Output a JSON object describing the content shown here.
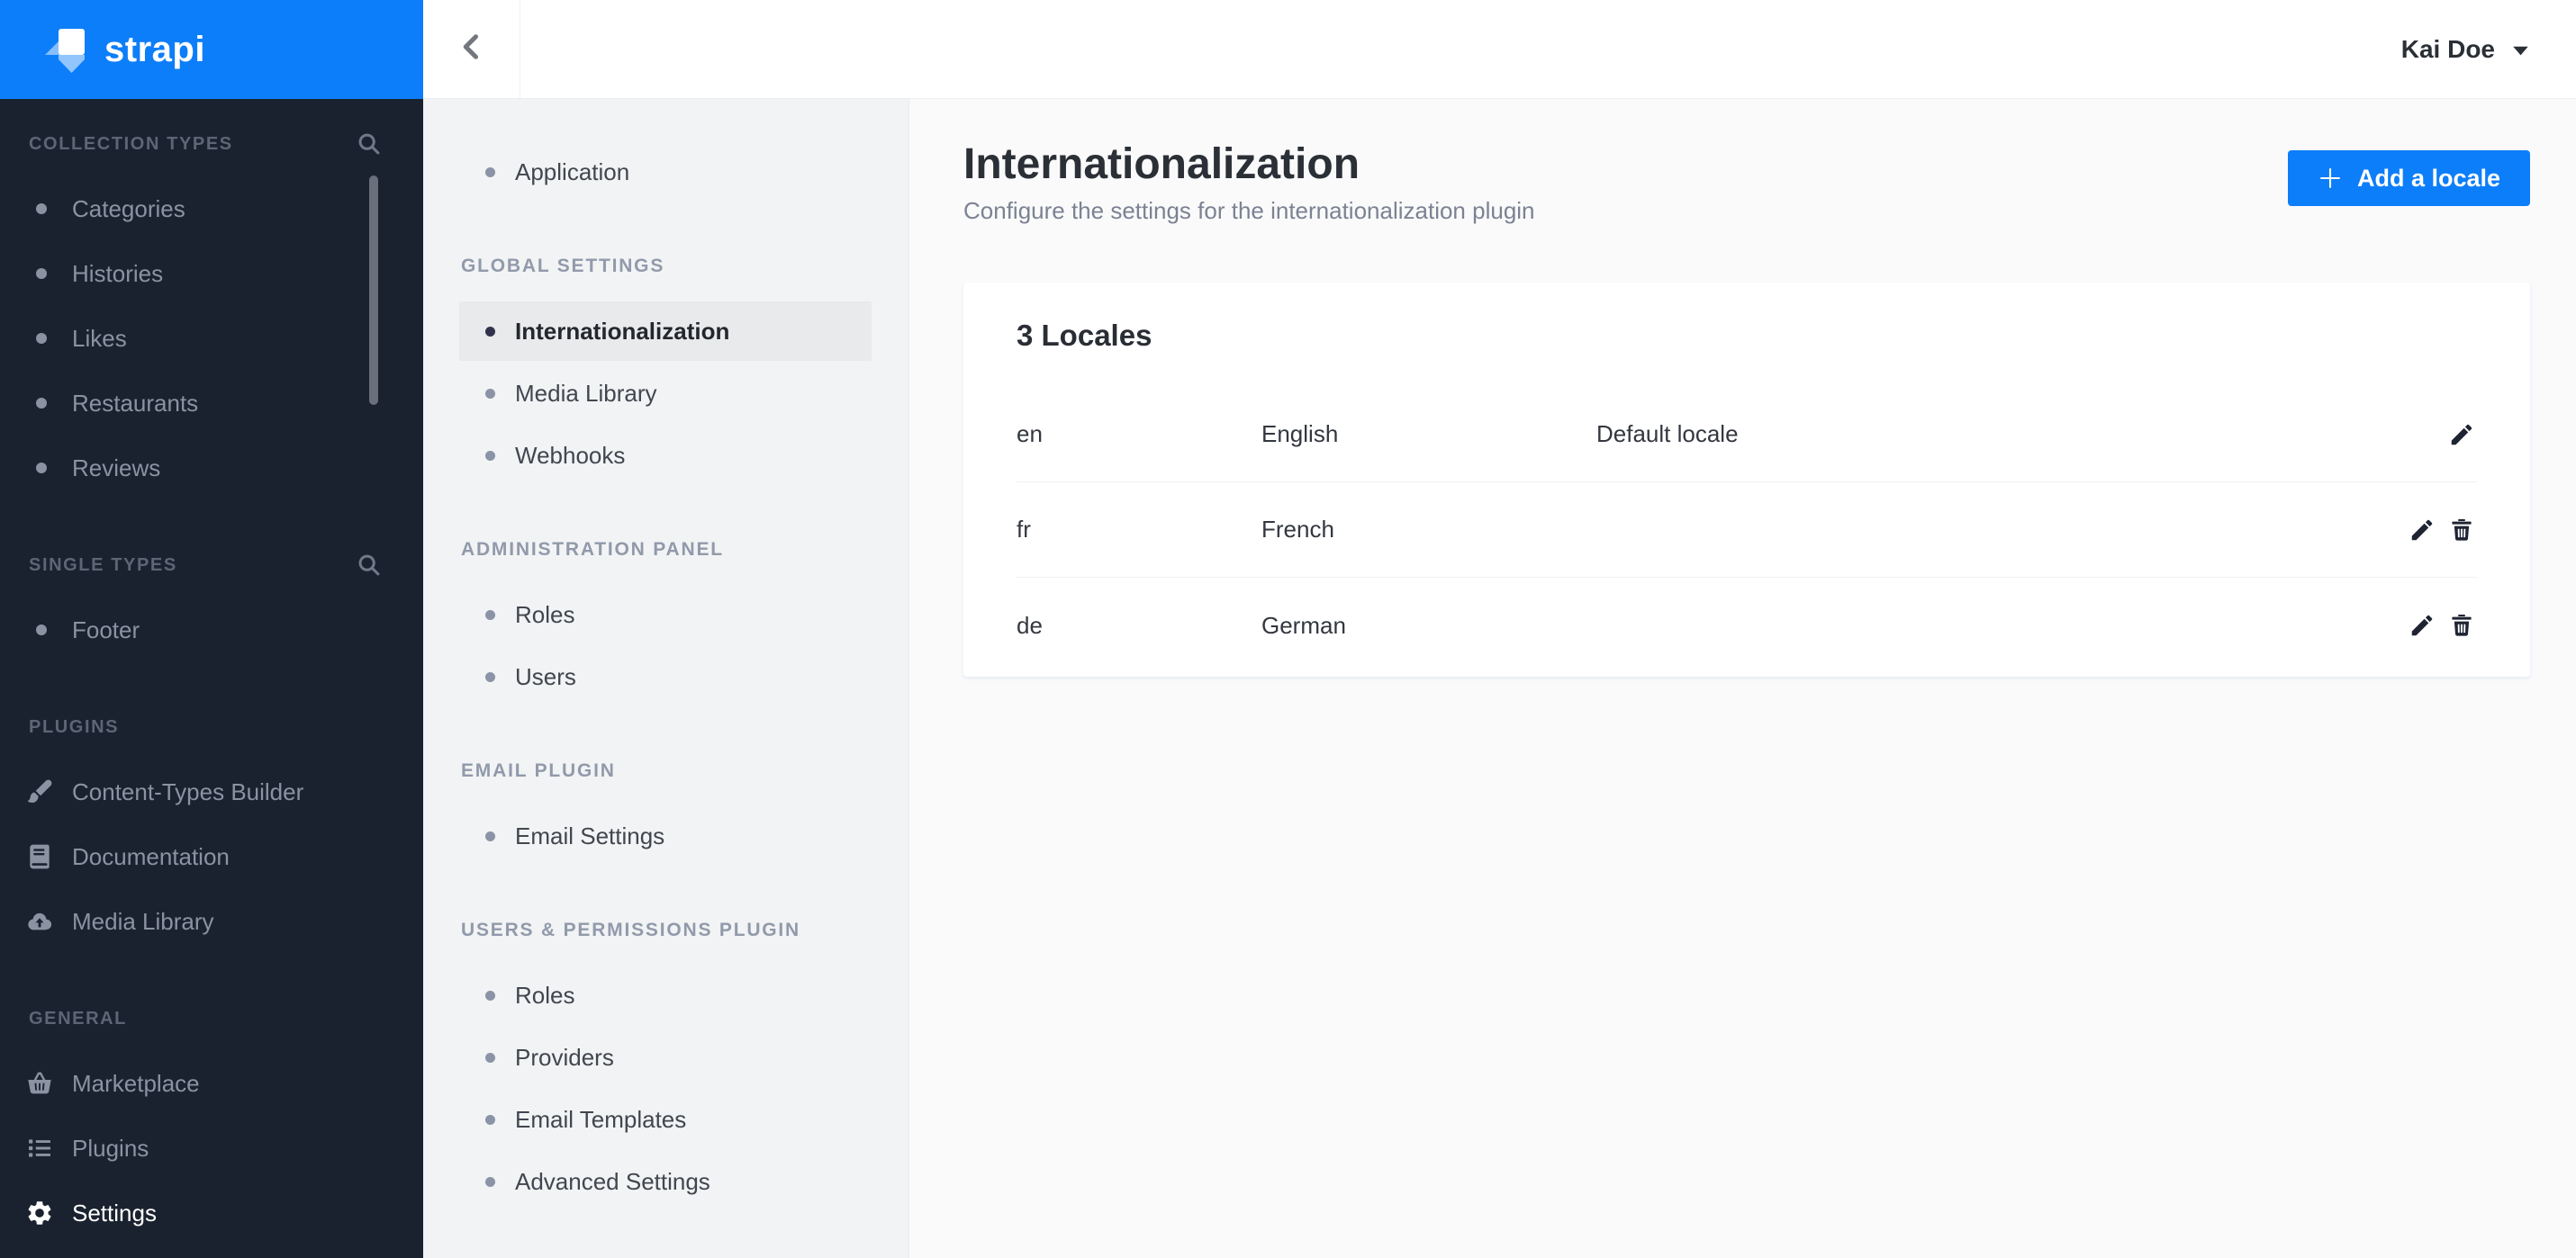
{
  "logo": {
    "text": "strapi"
  },
  "topbar": {
    "user_name": "Kai Doe",
    "back_icon": "chevron-left-icon",
    "user_menu_icon": "caret-down-icon"
  },
  "main_sidebar": {
    "sections": [
      {
        "label": "COLLECTION TYPES",
        "search_icon": "search-icon",
        "items": [
          {
            "label": "Categories"
          },
          {
            "label": "Histories"
          },
          {
            "label": "Likes"
          },
          {
            "label": "Restaurants"
          },
          {
            "label": "Reviews"
          }
        ]
      },
      {
        "label": "SINGLE TYPES",
        "search_icon": "search-icon",
        "items": [
          {
            "label": "Footer"
          }
        ]
      },
      {
        "label": "PLUGINS",
        "items": [
          {
            "label": "Content-Types Builder",
            "icon": "paintbrush-icon"
          },
          {
            "label": "Documentation",
            "icon": "book-icon"
          },
          {
            "label": "Media Library",
            "icon": "cloud-upload-icon"
          }
        ]
      },
      {
        "label": "GENERAL",
        "items": [
          {
            "label": "Marketplace",
            "icon": "basket-icon"
          },
          {
            "label": "Plugins",
            "icon": "list-icon"
          },
          {
            "label": "Settings",
            "icon": "gear-icon",
            "active": true
          }
        ]
      }
    ]
  },
  "settings_nav": {
    "standalone_item": {
      "label": "Application"
    },
    "sections": [
      {
        "label": "GLOBAL SETTINGS",
        "items": [
          {
            "label": "Internationalization",
            "active": true
          },
          {
            "label": "Media Library"
          },
          {
            "label": "Webhooks"
          }
        ]
      },
      {
        "label": "ADMINISTRATION PANEL",
        "items": [
          {
            "label": "Roles"
          },
          {
            "label": "Users"
          }
        ]
      },
      {
        "label": "EMAIL PLUGIN",
        "items": [
          {
            "label": "Email Settings"
          }
        ]
      },
      {
        "label": "USERS & PERMISSIONS PLUGIN",
        "items": [
          {
            "label": "Roles"
          },
          {
            "label": "Providers"
          },
          {
            "label": "Email Templates"
          },
          {
            "label": "Advanced Settings"
          }
        ]
      }
    ]
  },
  "page": {
    "title": "Internationalization",
    "subtitle": "Configure the settings for the internationalization plugin",
    "add_locale_button": {
      "label": "Add a locale",
      "icon": "plus-icon"
    }
  },
  "locales_card": {
    "title": "3 Locales",
    "rows": [
      {
        "code": "en",
        "name": "English",
        "note": "Default locale",
        "can_delete": false
      },
      {
        "code": "fr",
        "name": "French",
        "note": "",
        "can_delete": true
      },
      {
        "code": "de",
        "name": "German",
        "note": "",
        "can_delete": true
      }
    ]
  },
  "colors": {
    "accent_blue": "#0d7ef9",
    "sidebar_bg": "#1b222f",
    "settings_nav_bg": "#f2f3f4",
    "content_bg": "#fafafb",
    "active_item_bg": "#e9eaeb",
    "card_shadow": "#e3e9f3",
    "text_dark": "#2b2f36",
    "text_muted": "#7b8292"
  }
}
